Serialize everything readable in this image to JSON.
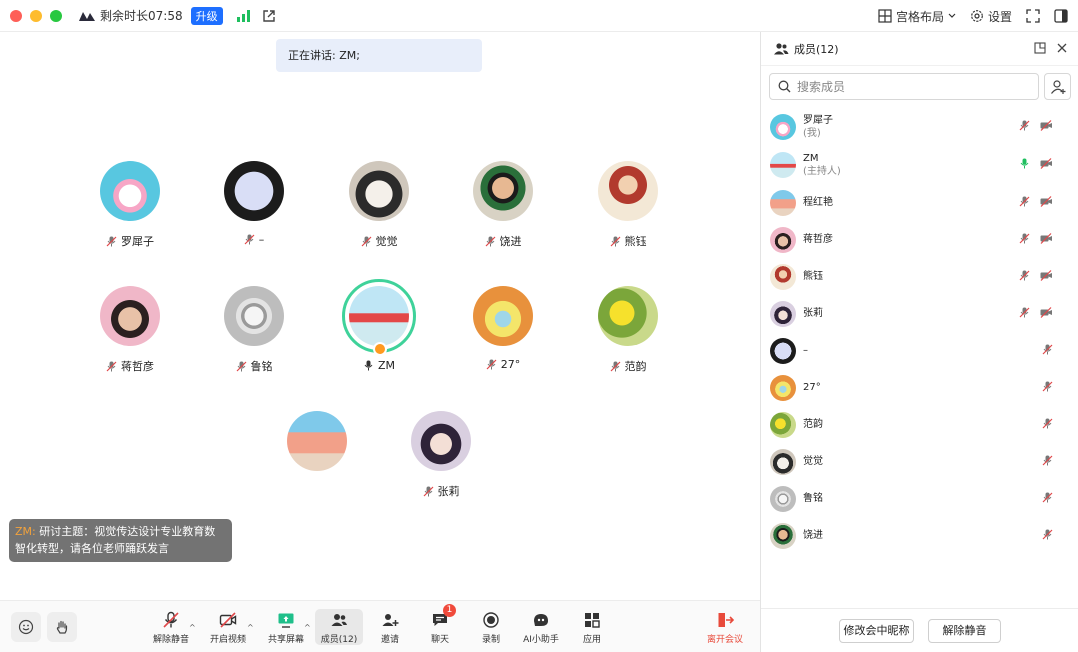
{
  "titlebar": {
    "remaining": "剩余时长07:58",
    "upgrade": "升级",
    "layout": "宫格布局",
    "settings": "设置"
  },
  "stage": {
    "speaking": "正在讲话: ZM;",
    "participants": [
      {
        "name": "罗犀子"
      },
      {
        "name": "–"
      },
      {
        "name": "觉觉"
      },
      {
        "name": "饶进"
      },
      {
        "name": "熊钰"
      },
      {
        "name": "蒋哲彦"
      },
      {
        "name": "鲁铭"
      },
      {
        "name": "ZM"
      },
      {
        "name": "27°"
      },
      {
        "name": "范韵"
      },
      {
        "name": ""
      },
      {
        "name": "张莉"
      }
    ],
    "subtitle_speaker": "ZM:",
    "subtitle_text": "研讨主题：视觉传达设计专业教育数智化转型，请各位老师踊跃发言"
  },
  "toolbar": {
    "unmute": "解除静音",
    "start_video": "开启视频",
    "share": "共享屏幕",
    "members": "成员(12)",
    "invite": "邀请",
    "chat": "聊天",
    "chat_badge": "1",
    "record": "录制",
    "ai": "AI小助手",
    "apps": "应用",
    "leave": "离开会议"
  },
  "panel": {
    "title": "成员(12)",
    "search_placeholder": "搜索成员",
    "members": [
      {
        "name": "罗犀子",
        "role": "(我)"
      },
      {
        "name": "ZM",
        "role": "(主持人)"
      },
      {
        "name": "程红艳",
        "role": ""
      },
      {
        "name": "蒋哲彦",
        "role": ""
      },
      {
        "name": "熊钰",
        "role": ""
      },
      {
        "name": "张莉",
        "role": ""
      },
      {
        "name": "–",
        "role": ""
      },
      {
        "name": "27°",
        "role": ""
      },
      {
        "name": "范韵",
        "role": ""
      },
      {
        "name": "觉觉",
        "role": ""
      },
      {
        "name": "鲁铭",
        "role": ""
      },
      {
        "name": "饶进",
        "role": ""
      }
    ],
    "rename_button": "修改会中昵称",
    "unmute_all_button": "解除静音"
  },
  "colors": {
    "accent": "#1e6fff",
    "speaking_ring": "#3fd29a",
    "leave": "#e84a3b",
    "mic_off": "#e0484a"
  }
}
